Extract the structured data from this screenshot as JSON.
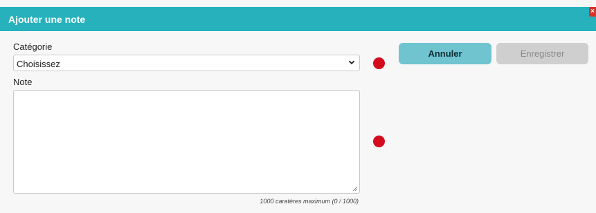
{
  "dialog": {
    "title": "Ajouter une note",
    "close_icon": "close-icon",
    "category_label": "Catégorie",
    "category_select": {
      "value": "Choisissez",
      "icon": "chevron-down-icon"
    },
    "note_label": "Note",
    "note_textarea": {
      "value": ""
    },
    "counter_text": "1000 caratères maximum (0 / 1000)",
    "buttons": {
      "cancel": "Annuler",
      "save": "Enregistrer"
    },
    "colors": {
      "header": "#26b1bd",
      "cancel": "#6fc4d0",
      "disabled": "#cfcfcf",
      "marker": "#d30b1c"
    }
  }
}
